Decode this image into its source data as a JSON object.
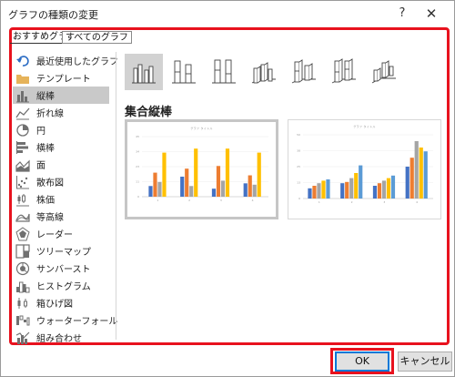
{
  "dialog": {
    "title": "グラフの種類の変更",
    "help_label": "?",
    "close_label": "✕"
  },
  "tabs": [
    {
      "label": "おすすめグラフ",
      "active": true
    },
    {
      "label": "すべてのグラフ",
      "active": false
    }
  ],
  "sidebar": {
    "selected_index": 2,
    "items": [
      {
        "label": "最近使用したグラフ",
        "icon": "undo-icon"
      },
      {
        "label": "テンプレート",
        "icon": "folder-icon"
      },
      {
        "label": "縦棒",
        "icon": "column-chart-icon"
      },
      {
        "label": "折れ線",
        "icon": "line-chart-icon"
      },
      {
        "label": "円",
        "icon": "pie-chart-icon"
      },
      {
        "label": "横棒",
        "icon": "bar-chart-icon"
      },
      {
        "label": "面",
        "icon": "area-chart-icon"
      },
      {
        "label": "散布図",
        "icon": "scatter-chart-icon"
      },
      {
        "label": "株価",
        "icon": "stock-chart-icon"
      },
      {
        "label": "等高線",
        "icon": "surface-chart-icon"
      },
      {
        "label": "レーダー",
        "icon": "radar-chart-icon"
      },
      {
        "label": "ツリーマップ",
        "icon": "treemap-chart-icon"
      },
      {
        "label": "サンバースト",
        "icon": "sunburst-chart-icon"
      },
      {
        "label": "ヒストグラム",
        "icon": "histogram-chart-icon"
      },
      {
        "label": "箱ひげ図",
        "icon": "box-whisker-chart-icon"
      },
      {
        "label": "ウォーターフォール",
        "icon": "waterfall-chart-icon"
      },
      {
        "label": "組み合わせ",
        "icon": "combo-chart-icon"
      }
    ]
  },
  "subtypes": {
    "selected_index": 0,
    "items": [
      {
        "icon": "clustered-column-icon"
      },
      {
        "icon": "stacked-column-icon"
      },
      {
        "icon": "100-stacked-column-icon"
      },
      {
        "icon": "3d-clustered-column-icon"
      },
      {
        "icon": "3d-stacked-column-icon"
      },
      {
        "icon": "3d-100-stacked-column-icon"
      },
      {
        "icon": "3d-column-icon"
      }
    ]
  },
  "selected_type_label": "集合縦棒",
  "colors": {
    "series": [
      "#4472c4",
      "#ed7d31",
      "#a5a5a5",
      "#ffc000",
      "#5b9bd5"
    ],
    "icon_gray": "#707070",
    "highlight_red": "#e8121e"
  },
  "previews": [
    {
      "title": "グラフ タイトル",
      "selected": true,
      "chart_data": {
        "type": "bar",
        "categories": [
          "1",
          "2",
          "3",
          "4"
        ],
        "series": [
          {
            "values": [
              8,
              15,
              6,
              10
            ]
          },
          {
            "values": [
              18,
              21,
              23,
              16
            ]
          },
          {
            "values": [
              11,
              8,
              12,
              9
            ]
          },
          {
            "values": [
              33,
              36,
              36,
              33
            ]
          }
        ],
        "ylim": [
          0,
          45
        ]
      }
    },
    {
      "title": "グラフ タイトル",
      "selected": false,
      "chart_data": {
        "type": "bar",
        "categories": [
          "1",
          "2",
          "3",
          "4"
        ],
        "series": [
          {
            "values": [
              8,
              12,
              10,
              25
            ]
          },
          {
            "values": [
              10,
              13,
              12,
              32
            ]
          },
          {
            "values": [
              12,
              16,
              14,
              45
            ]
          },
          {
            "values": [
              14,
              20,
              16,
              40
            ]
          },
          {
            "values": [
              15,
              26,
              18,
              37
            ]
          }
        ],
        "ylim": [
          0,
          50
        ]
      }
    }
  ],
  "buttons": {
    "ok_label": "OK",
    "cancel_label": "キャンセル"
  }
}
